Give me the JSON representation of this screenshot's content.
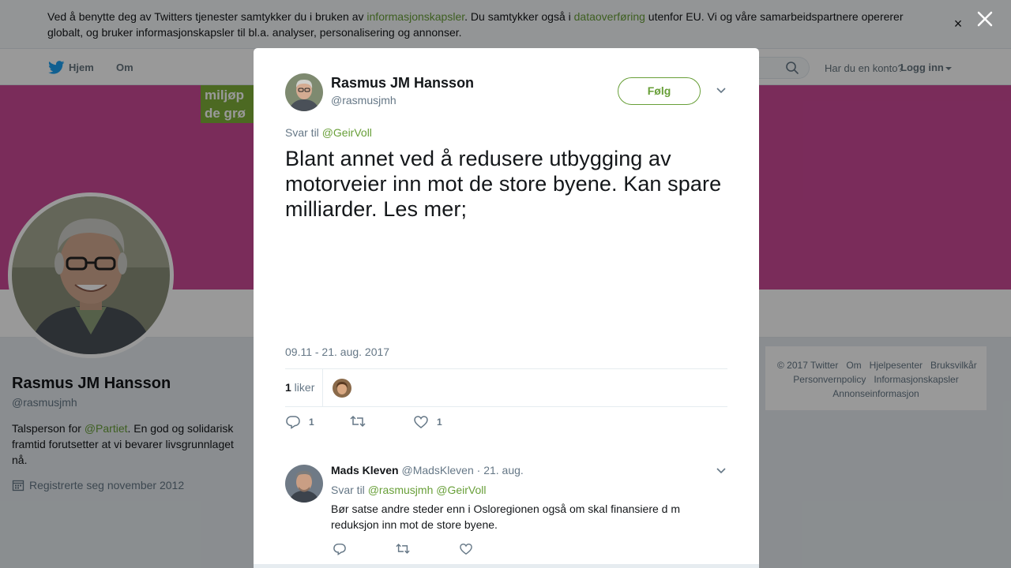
{
  "cookie_banner": {
    "text_1": "Ved å benytte deg av Twitters tjenester samtykker du i bruken av ",
    "link_1": "informasjonskapsler",
    "text_2": ". Du samtykker også i ",
    "link_2": "dataoverføring",
    "text_3": " utenfor EU. Vi og våre samarbeidspartnere opererer globalt, og bruker informasjonskapsler til bl.a. analyser, personalisering og annonser.",
    "close_glyph": "×"
  },
  "topnav": {
    "home": "Hjem",
    "about": "Om",
    "account_prompt": "Har du en konto?",
    "login": "Logg inn"
  },
  "banner": {
    "logo_line_1": "miljøp",
    "logo_line_2": "de grø"
  },
  "profile": {
    "name": "Rasmus JM Hansson",
    "handle": "@rasmusjmh",
    "bio_1": "Talsperson for ",
    "bio_link": "@Partiet",
    "bio_2": ". En god og solidarisk framtid forutsetter at vi bevarer livsgrunnlaget nå.",
    "joined": "Registrerte seg november 2012"
  },
  "footer": {
    "links": [
      "© 2017 Twitter",
      "Om",
      "Hjelpesenter",
      "Bruksvilkår",
      "Personvernpolicy",
      "Informasjonskapsler",
      "Annonseinformasjon"
    ]
  },
  "tweet": {
    "author_name": "Rasmus JM Hansson",
    "author_handle": "@rasmusjmh",
    "follow_label": "Følg",
    "reply_to_label": "Svar til ",
    "reply_to_user": "@GeirVoll",
    "text": "Blant annet ved å redusere utbygging av motorveier inn mot de store byene. Kan spare milliarder. Les mer;",
    "timestamp": "09.11 - 21. aug. 2017",
    "likes_count": "1",
    "likes_label": " liker",
    "reply_count": "1",
    "retweet_count": "",
    "like_count": "1"
  },
  "reply": {
    "author_name": "Mads Kleven",
    "author_handle": "@MadsKleven",
    "date": " · 21. aug.",
    "reply_to_label": "Svar til ",
    "reply_to_user_1": "@rasmusjmh",
    "reply_to_user_2": "@GeirVoll",
    "text": "Bør satse andre steder enn i Osloregionen også om skal finansiere d m reduksjon inn mot de store byene."
  },
  "colors": {
    "link_accent": "#689f38",
    "banner": "#cc4a97",
    "twitter_blue": "#1da1f2"
  }
}
